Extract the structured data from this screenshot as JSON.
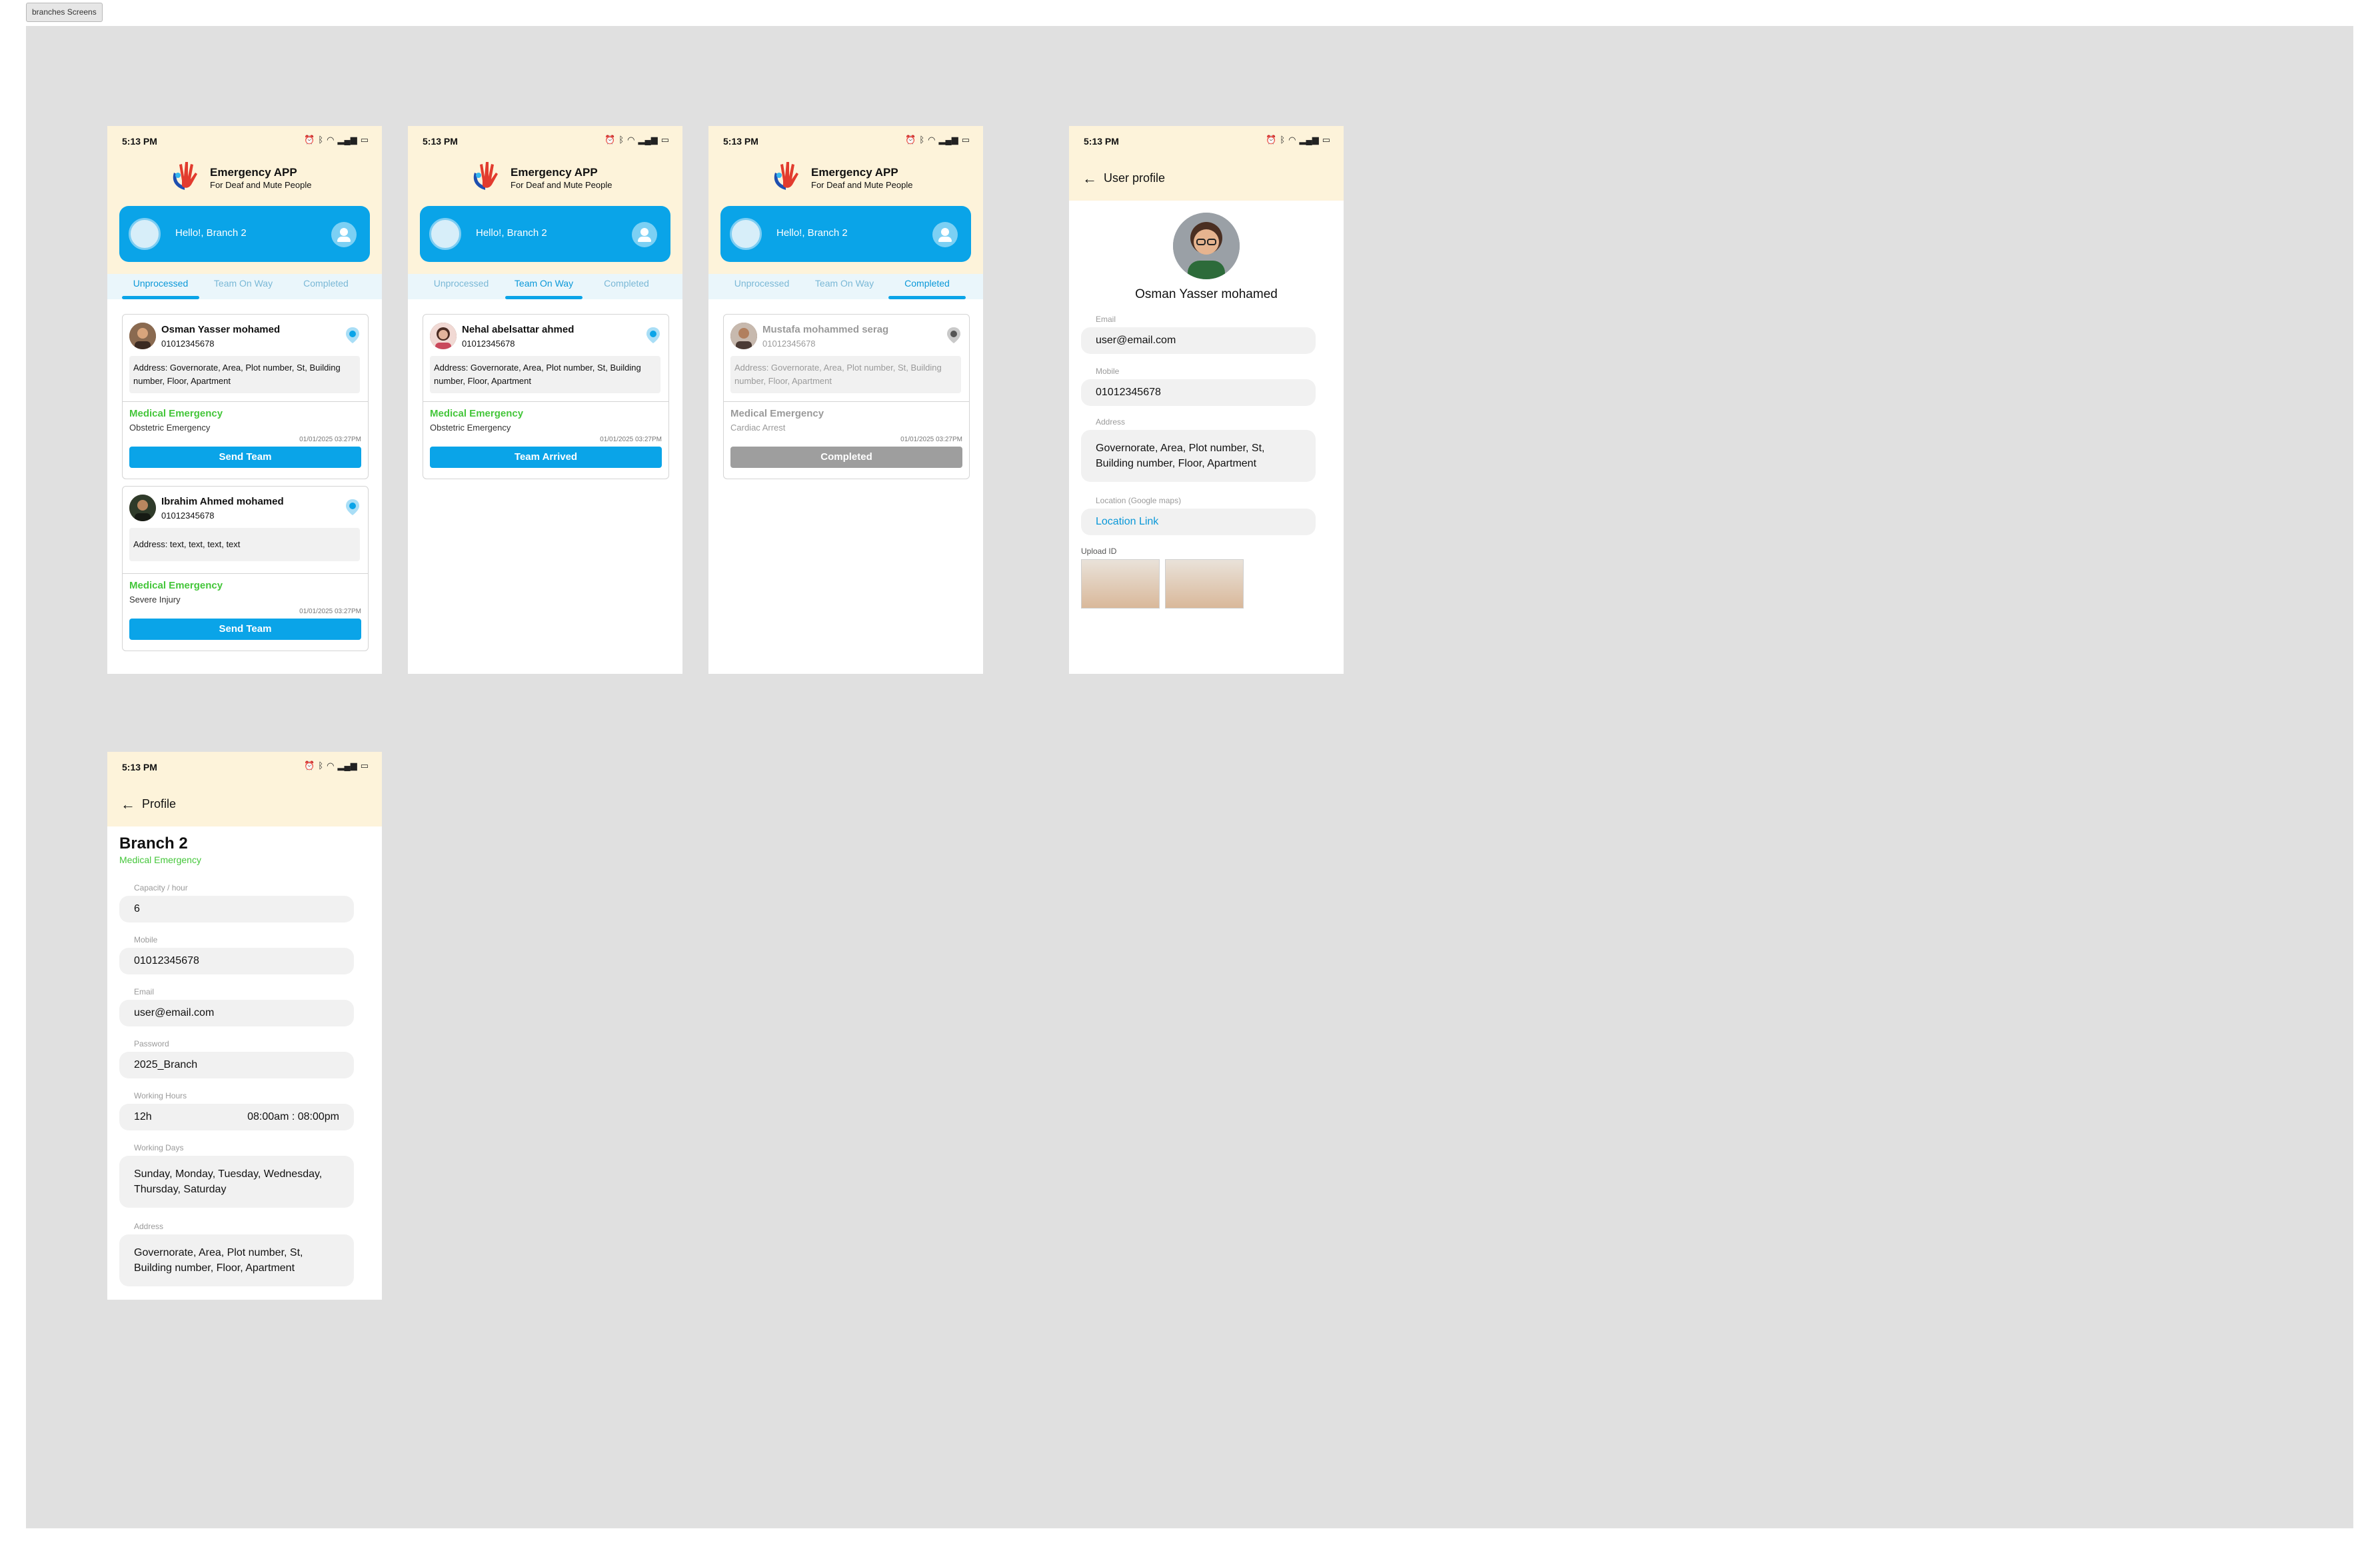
{
  "frame_label": "branches Screens",
  "common": {
    "time": "5:13 PM",
    "app_name": "Emergency APP",
    "app_tagline": "For Deaf and Mute People",
    "greeting": "Hello!, Branch 2",
    "tabs": [
      "Unprocessed",
      "Team On Way",
      "Completed"
    ]
  },
  "screen1": {
    "active_tab": "Unprocessed",
    "cards": [
      {
        "name": "Osman Yasser mohamed",
        "phone": "01012345678",
        "address": "Address: Governorate, Area, Plot number, St, Building number, Floor, Apartment",
        "category": "Medical Emergency",
        "subcategory": "Obstetric Emergency",
        "date": "01/01/2025 03:27PM",
        "button": "Send Team"
      },
      {
        "name": "Ibrahim Ahmed mohamed",
        "phone": "01012345678",
        "address": "Address: text, text, text, text",
        "category": "Medical Emergency",
        "subcategory": "Severe Injury",
        "date": "01/01/2025 03:27PM",
        "button": "Send Team"
      }
    ]
  },
  "screen2": {
    "active_tab": "Team On Way",
    "card": {
      "name": "Nehal abelsattar ahmed",
      "phone": "01012345678",
      "address": "Address: Governorate, Area, Plot number, St, Building number, Floor, Apartment",
      "category": "Medical Emergency",
      "subcategory": "Obstetric Emergency",
      "date": "01/01/2025 03:27PM",
      "button": "Team Arrived"
    }
  },
  "screen3": {
    "active_tab": "Completed",
    "card": {
      "name": "Mustafa mohammed serag",
      "phone": "01012345678",
      "address": "Address: Governorate, Area, Plot number, St, Building number, Floor, Apartment",
      "category": "Medical Emergency",
      "subcategory": "Cardiac Arrest",
      "date": "01/01/2025 03:27PM",
      "button": "Completed"
    }
  },
  "user_profile": {
    "title": "User profile",
    "name": "Osman Yasser mohamed",
    "email_label": "Email",
    "email": "user@email.com",
    "mobile_label": "Mobile",
    "mobile": "01012345678",
    "address_label": "Address",
    "address": "Governorate, Area, Plot number, St, Building number, Floor, Apartment",
    "location_label": "Location (Google maps)",
    "location_link": "Location Link",
    "upload_label": "Upload ID"
  },
  "branch_profile": {
    "title": "Profile",
    "branch_name": "Branch 2",
    "branch_type": "Medical Emergency",
    "capacity_label": "Capacity / hour",
    "capacity": "6",
    "mobile_label": "Mobile",
    "mobile": "01012345678",
    "email_label": "Email",
    "email": "user@email.com",
    "password_label": "Password",
    "password": "2025_Branch",
    "hours_label": "Working Hours",
    "hours_total": "12h",
    "hours_range": "08:00am : 08:00pm",
    "days_label": "Working Days",
    "days": "Sunday, Monday, Tuesday, Wednesday, Thursday, Saturday",
    "address_label": "Address",
    "address": "Governorate, Area, Plot number, St, Building number, Floor, Apartment"
  },
  "colors": {
    "accent": "#0aa4e8",
    "header_bg": "#fdf3da",
    "success_green": "#44c63a",
    "canvas_bg": "#e0e0e0",
    "disabled": "#9e9e9e"
  }
}
